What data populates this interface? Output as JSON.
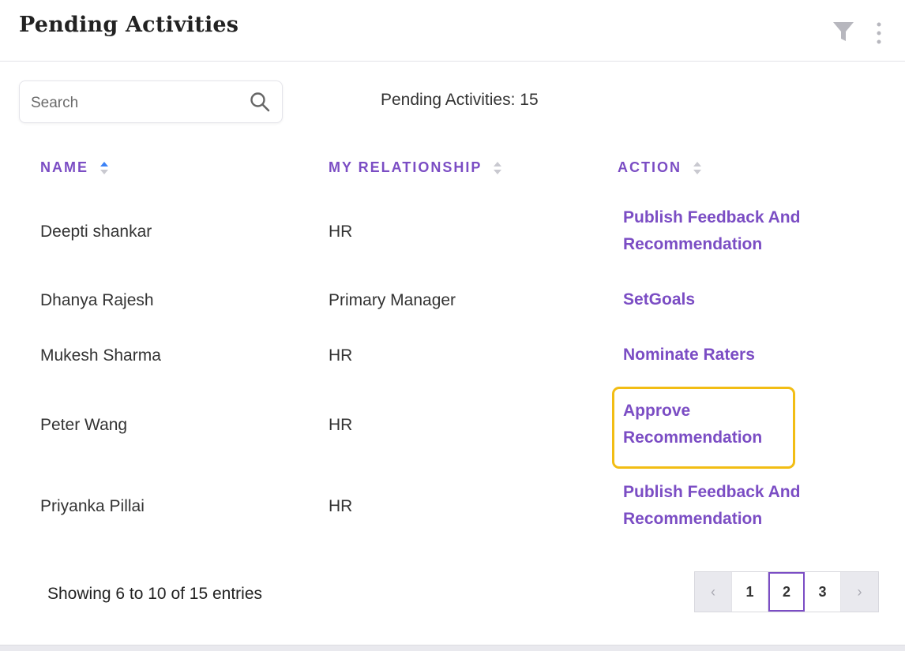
{
  "header": {
    "title": "Pending Activities"
  },
  "search": {
    "placeholder": "Search",
    "value": ""
  },
  "summary": {
    "pending_label": "Pending Activities: 15"
  },
  "table": {
    "columns": [
      "NAME",
      "MY RELATIONSHIP",
      "ACTION"
    ],
    "rows": [
      {
        "name": "Deepti shankar",
        "relationship": "HR",
        "action": [
          "Publish Feedback And",
          "Recommendation"
        ]
      },
      {
        "name": "Dhanya Rajesh",
        "relationship": "Primary Manager",
        "action": [
          "SetGoals"
        ]
      },
      {
        "name": "Mukesh Sharma",
        "relationship": "HR",
        "action": [
          "Nominate Raters"
        ]
      },
      {
        "name": "Peter Wang",
        "relationship": "HR",
        "action": [
          "Approve",
          "Recommendation"
        ]
      },
      {
        "name": "Priyanka Pillai",
        "relationship": "HR",
        "action": [
          "Publish Feedback And",
          "Recommendation"
        ]
      }
    ]
  },
  "footer": {
    "info": "Showing 6 to 10 of 15 entries",
    "pages": [
      "1",
      "2",
      "3"
    ],
    "current_page": "2",
    "prev_glyph": "‹",
    "next_glyph": "›"
  },
  "colors": {
    "accent": "#7b4dc4",
    "highlight": "#f2bd14",
    "text": "#333333"
  },
  "icons": [
    "filter-icon",
    "more-vertical-icon",
    "search-icon",
    "sort-icon",
    "chevron-left-icon",
    "chevron-right-icon"
  ]
}
